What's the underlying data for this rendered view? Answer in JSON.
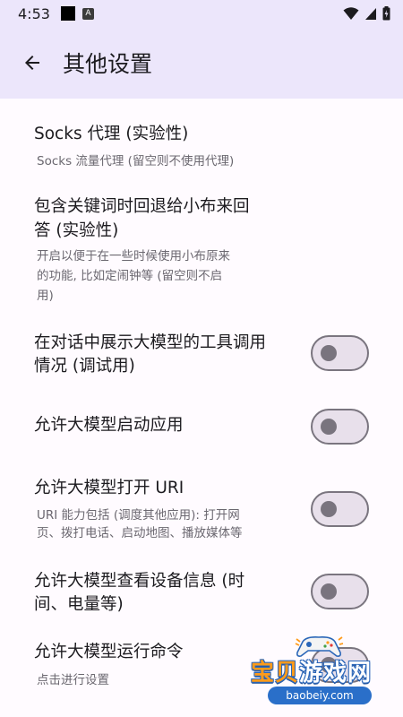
{
  "status_bar": {
    "time": "4:53",
    "notification_icon_letter": "A"
  },
  "header": {
    "title": "其他设置"
  },
  "settings": [
    {
      "title": "Socks 代理 (实验性)",
      "description": "Socks 流量代理 (留空则不使用代理)",
      "has_switch": false
    },
    {
      "title_lines": [
        "包含关键词时回退给小布来回",
        "答 (实验性)"
      ],
      "description_lines": [
        "开启以便于在一些时候使用小布原来",
        "的功能, 比如定闹钟等 (留空则不启",
        "用)"
      ],
      "has_switch": false
    },
    {
      "title_lines": [
        "在对话中展示大模型的工具调用",
        "情况 (调试用)"
      ],
      "has_switch": true,
      "switch_on": false
    },
    {
      "title": "允许大模型启动应用",
      "has_switch": true,
      "switch_on": false
    },
    {
      "title": "允许大模型打开 URI",
      "description_lines": [
        "URI 能力包括 (调度其他应用): 打开网",
        "页、拨打电话、启动地图、播放媒体等"
      ],
      "has_switch": true,
      "switch_on": false
    },
    {
      "title_lines": [
        "允许大模型查看设备信息 (时",
        "间、电量等)"
      ],
      "has_switch": true,
      "switch_on": false
    },
    {
      "title": "允许大模型运行命令",
      "description": "点击进行设置",
      "has_switch": true,
      "switch_on": false
    }
  ],
  "watermark": {
    "text_part1": "宝贝",
    "text_part2": "游戏网",
    "url": "baobeiy.com"
  },
  "colors": {
    "app_bar": "#ece6fb",
    "background": "#fffbff",
    "switch_outline": "#7a757f",
    "switch_track": "#e8e0eb",
    "switch_thumb": "#79747e"
  }
}
